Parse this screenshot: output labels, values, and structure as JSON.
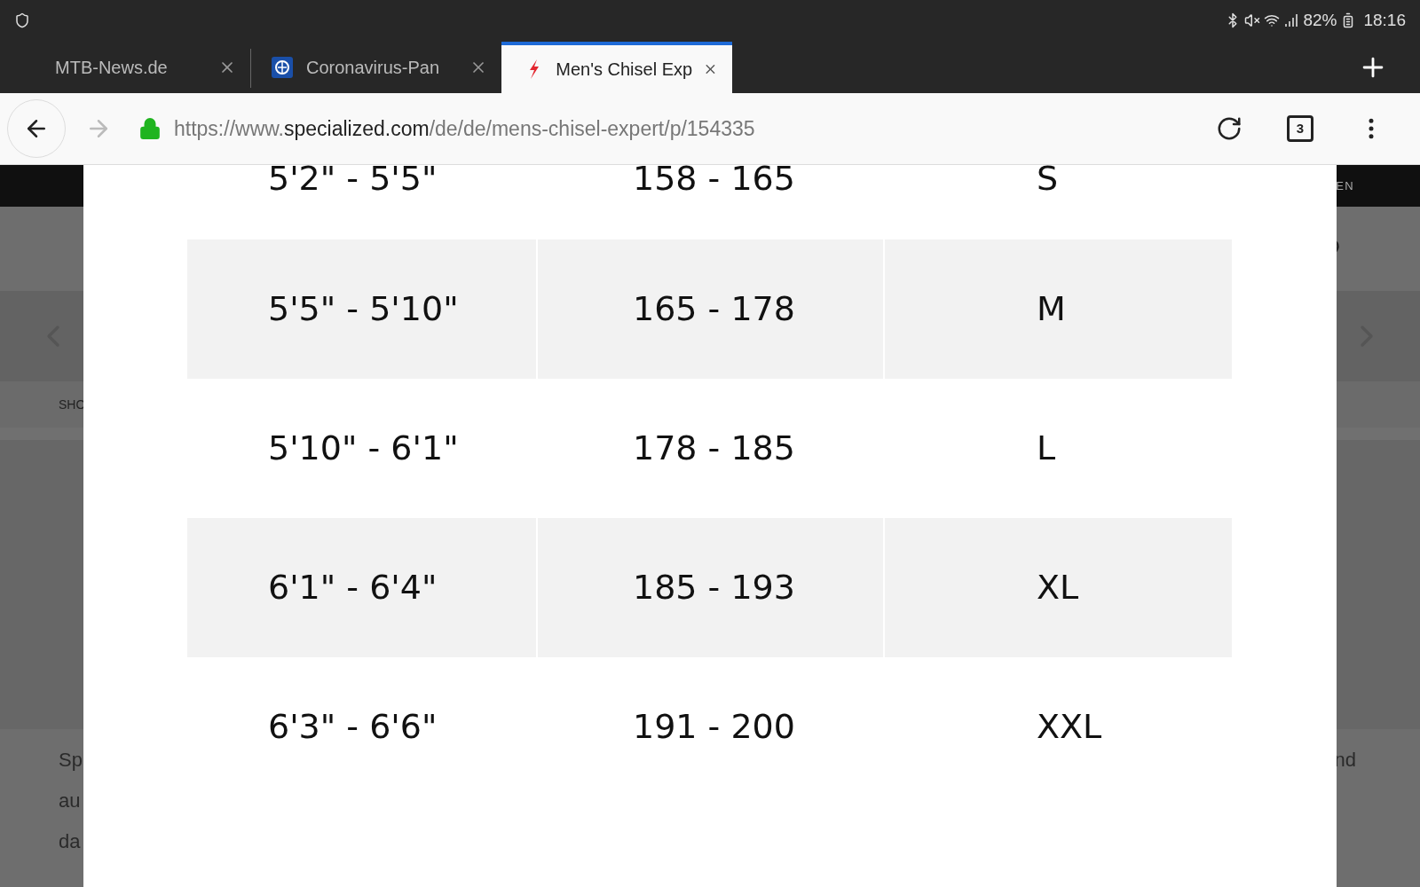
{
  "status_bar": {
    "battery": "82%",
    "time": "18:16"
  },
  "tabs": [
    {
      "title": "MTB-News.de",
      "selected": false,
      "kind": "plain"
    },
    {
      "title": "Coronavirus-Pan",
      "selected": false,
      "kind": "globe"
    },
    {
      "title": "Men's Chisel Exp",
      "selected": true,
      "kind": "bolt"
    }
  ],
  "address_bar": {
    "url_prefix": "https://www.",
    "url_domain": "specialized.com",
    "url_path": "/de/de/mens-chisel-expert/p/154335",
    "secure": true,
    "tab_count": "3"
  },
  "background_page": {
    "top_strip": "EN",
    "breadcrumb": "SHO",
    "text_left": [
      "Sp",
      "au",
      "da"
    ],
    "text_right": "nd"
  },
  "size_table": {
    "rows": [
      {
        "height_ft": "5'2\" - 5'5\"",
        "height_cm": "158 - 165",
        "size": "S"
      },
      {
        "height_ft": "5'5\" - 5'10\"",
        "height_cm": "165 - 178",
        "size": "M"
      },
      {
        "height_ft": "5'10\" - 6'1\"",
        "height_cm": "178 - 185",
        "size": "L"
      },
      {
        "height_ft": "6'1\" - 6'4\"",
        "height_cm": "185 - 193",
        "size": "XL"
      },
      {
        "height_ft": "6'3\" - 6'6\"",
        "height_cm": "191 - 200",
        "size": "XXL"
      }
    ]
  }
}
